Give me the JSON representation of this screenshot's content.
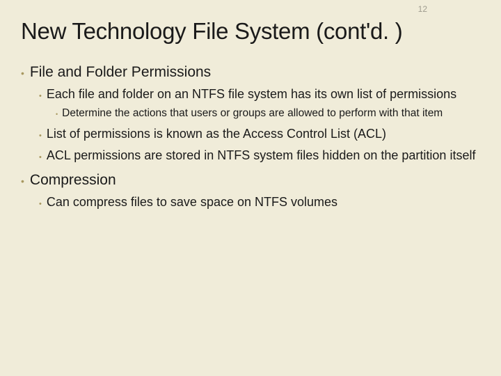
{
  "page_number": "12",
  "title": "New Technology File System (cont'd. )",
  "bullets": [
    {
      "text": "File and Folder Permissions",
      "children": [
        {
          "text": "Each file and folder on an NTFS file system has its own list of permissions",
          "children": [
            {
              "text": "Determine the actions that users or groups are allowed to perform with that item"
            }
          ]
        },
        {
          "text": "List of permissions is known as the Access Control List (ACL)"
        },
        {
          "text": "ACL permissions are stored in NTFS system files hidden on the partition itself"
        }
      ]
    },
    {
      "text": "Compression",
      "children": [
        {
          "text": "Can compress files to save space on NTFS volumes"
        }
      ]
    }
  ]
}
